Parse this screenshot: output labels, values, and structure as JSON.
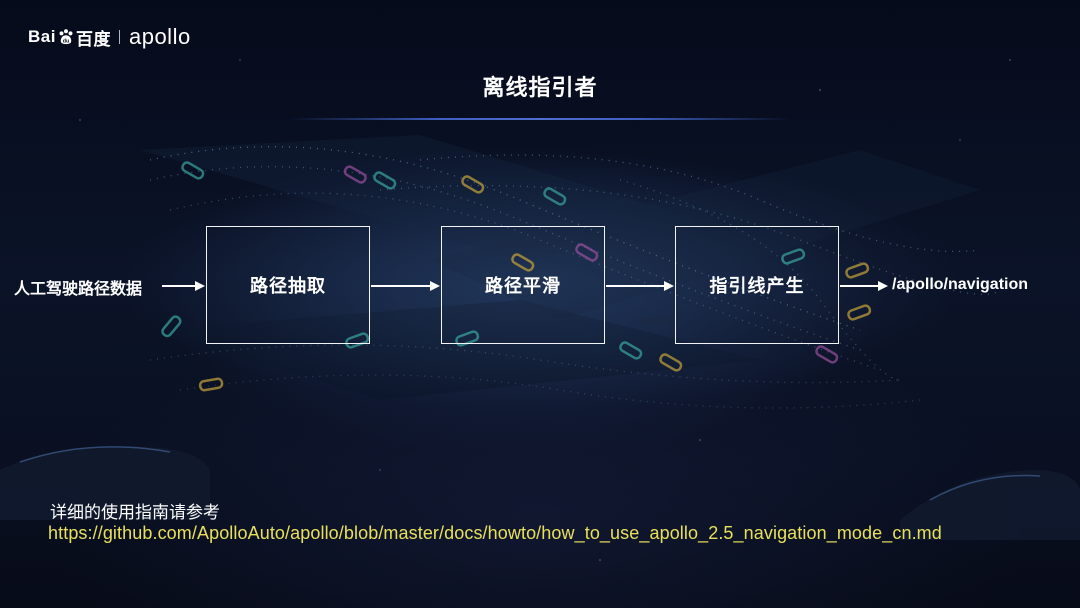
{
  "header": {
    "brand_left": "Bai",
    "brand_cn": "百度",
    "brand_right": "apollo"
  },
  "title": "离线指引者",
  "flow": {
    "input": "人工驾驶路径数据",
    "steps": [
      "路径抽取",
      "路径平滑",
      "指引线产生"
    ],
    "output": "/apollo/navigation"
  },
  "note": {
    "label": "详细的使用指南请参考",
    "link": "https://github.com/ApolloAuto/apollo/blob/master/docs/howto/how_to_use_apollo_2.5_navigation_mode_cn.md"
  },
  "colors": {
    "background": "#070c1d",
    "text": "#ffffff",
    "link": "#e8e05c",
    "title_underline": "#4f6fd0",
    "box_border": "#f2f4f8"
  }
}
